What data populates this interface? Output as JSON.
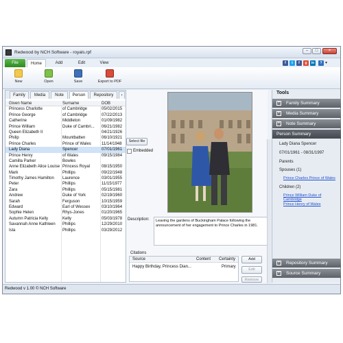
{
  "window": {
    "title": "Redwood by NCH Software - royals.rpf",
    "min": "–",
    "max": "□",
    "close": "×"
  },
  "menu": {
    "file": "File",
    "tabs": [
      "Home",
      "Add",
      "Edit",
      "View"
    ]
  },
  "social": [
    "f",
    "t",
    "f",
    "g",
    "in",
    "?"
  ],
  "toolbar": {
    "new": "New",
    "open": "Open",
    "save": "Save",
    "export": "Export to PDF"
  },
  "subtabs": [
    "Family",
    "Media",
    "Note",
    "Person",
    "Repository"
  ],
  "table": {
    "headers": [
      "Given Name",
      "Surname",
      "DOB"
    ],
    "rows": [
      [
        "Princess Charlotte",
        "of Cambridge",
        "05/02/2015"
      ],
      [
        "Prince George",
        "of Cambridge",
        "07/22/2013"
      ],
      [
        "Catherine",
        "Middleton",
        "01/09/1982"
      ],
      [
        "Prince William",
        "Duke of Cambri...",
        "06/21/1982"
      ],
      [
        "Queen Elizabeth II",
        "",
        "04/21/1926"
      ],
      [
        "Philip",
        "Mountbatten",
        "06/10/1921"
      ],
      [
        "Prince Charles",
        "Prince of Wales",
        "11/14/1948"
      ],
      [
        "Lady Diana",
        "Spencer",
        "07/01/1961"
      ],
      [
        "Prince Henry",
        "of Wales",
        "09/15/1984"
      ],
      [
        "Camilla Parker",
        "Bowles",
        ""
      ],
      [
        "Anne Elizabeth Alice Louise",
        "Princess Royal",
        "08/15/1950"
      ],
      [
        "Mark",
        "Phillips",
        "09/22/1948"
      ],
      [
        "Timothy James Hamilton",
        "Laurence",
        "03/01/1955"
      ],
      [
        "Peter",
        "Phillips",
        "11/15/1977"
      ],
      [
        "Zara",
        "Phillips",
        "05/15/1981"
      ],
      [
        "Andrew",
        "Duke of York",
        "02/19/1960"
      ],
      [
        "Sarah",
        "Ferguson",
        "10/15/1959"
      ],
      [
        "Edward",
        "Earl of Wessex",
        "03/10/1964"
      ],
      [
        "Sophie Helen",
        "Rhys-Jones",
        "01/20/1965"
      ],
      [
        "Autumn Patricia Kelly",
        "Kelly",
        "05/03/1978"
      ],
      [
        "Savannah Anne Kathleen",
        "Phillips",
        "12/29/2010"
      ],
      [
        "Isla",
        "Phillips",
        "03/29/2012"
      ]
    ],
    "selected": 7
  },
  "media": {
    "select_file": "Select file",
    "embedded": "Embedded",
    "description_label": "Description:",
    "description": "Leaving the gardens of Buckingham Palace following the announcement of her engagement to Prince Charles in 1981."
  },
  "citations": {
    "label": "Citations",
    "headers": [
      "Source",
      "Content",
      "Certainty"
    ],
    "rows": [
      [
        "Happy Birthday, Princess Dian...",
        "",
        "Primary"
      ]
    ],
    "buttons": [
      "Add",
      "Edit",
      "Remove"
    ]
  },
  "tools": {
    "title": "Tools",
    "sections": [
      "Family Summary",
      "Media Summary",
      "Note Summary"
    ],
    "active": "Person Summary",
    "bottom": [
      "Repository Summary",
      "Source Summary"
    ]
  },
  "person": {
    "name": "Lady Diana Spencer",
    "dates": "07/01/1961 - 08/31/1997",
    "parents": "Parents",
    "spouses": "Spouses (1)",
    "spouse_link": "Prince Charles Prince of Wales",
    "children": "Children (2)",
    "child1": "Prince William Duke of Cambridge",
    "child2": "Prince Henry of Wales"
  },
  "status": "Redwood v 1.00 © NCH Software"
}
